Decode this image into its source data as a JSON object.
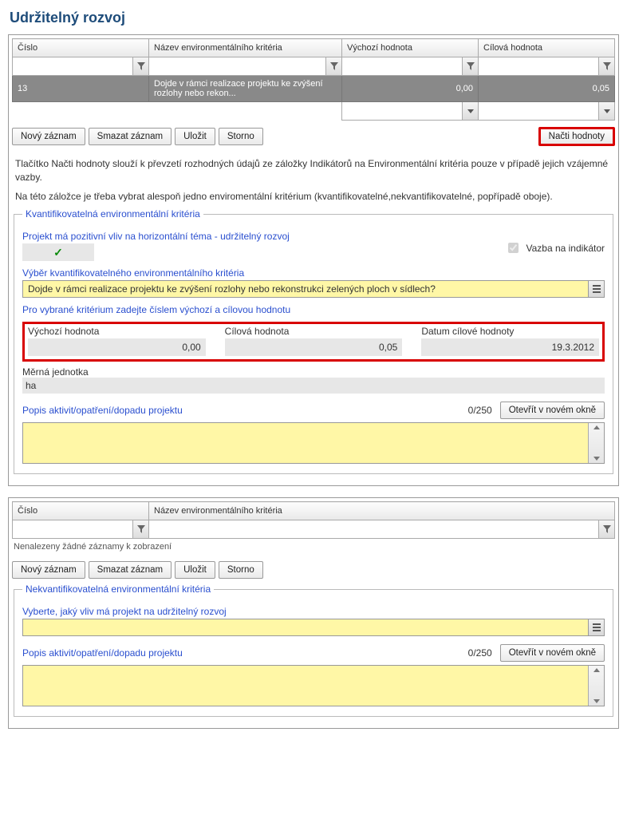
{
  "title": "Udržitelný rozvoj",
  "table1": {
    "headers": {
      "cislo": "Číslo",
      "nazev": "Název environmentálního kritéria",
      "vychozi": "Výchozí hodnota",
      "cilova": "Cílová hodnota"
    },
    "row": {
      "cislo": "13",
      "nazev": "Dojde v rámci realizace projektu ke zvýšení rozlohy nebo rekon...",
      "vychozi": "0,00",
      "cilova": "0,05"
    }
  },
  "buttons": {
    "novy": "Nový záznam",
    "smazat": "Smazat záznam",
    "ulozit": "Uložit",
    "storno": "Storno",
    "nacti": "Načti hodnoty",
    "otevrit": "Otevřít v novém okně"
  },
  "info": {
    "p1": "Tlačítko Načti hodnoty slouží k převzetí rozhodných údajů ze záložky Indikátorů na Environmentální kritéria pouze v případě jejich vzájemné vazby.",
    "p2": "Na této záložce je třeba vybrat alespoň jedno enviromentální kritérium (kvantifikovatelné,nekvantifikovatelné, popřípadě oboje)."
  },
  "kv": {
    "legend": "Kvantifikovatelná environmentální kritéria",
    "posLabel": "Projekt má pozitivní vliv na horizontální téma - udržitelný rozvoj",
    "vazba": "Vazba na indikátor",
    "vyberLabel": "Výběr kvantifikovatelného environmentálního kritéria",
    "vyberValue": "Dojde v rámci realizace projektu ke zvýšení rozlohy nebo rekonstrukci zelených ploch v sídlech?",
    "proVybrane": "Pro vybrané kritérium zadejte číslem výchozí a cílovou hodnotu",
    "vychoziLabel": "Výchozí hodnota",
    "vychoziVal": "0,00",
    "cilovaLabel": "Cílová hodnota",
    "cilovaVal": "0,05",
    "datumLabel": "Datum cílové hodnoty",
    "datumVal": "19.3.2012",
    "mernaLabel": "Měrná jednotka",
    "mernaVal": "ha",
    "popisLabel": "Popis aktivit/opatření/dopadu projektu",
    "counter": "0/250"
  },
  "table2": {
    "headers": {
      "cislo": "Číslo",
      "nazev": "Název environmentálního kritéria"
    },
    "empty": "Nenalezeny žádné záznamy k zobrazení"
  },
  "nk": {
    "legend": "Nekvantifikovatelná environmentální kritéria",
    "vyberteLabel": "Vyberte, jaký vliv má projekt na udržitelný rozvoj",
    "popisLabel": "Popis aktivit/opatření/dopadu projektu",
    "counter": "0/250"
  }
}
